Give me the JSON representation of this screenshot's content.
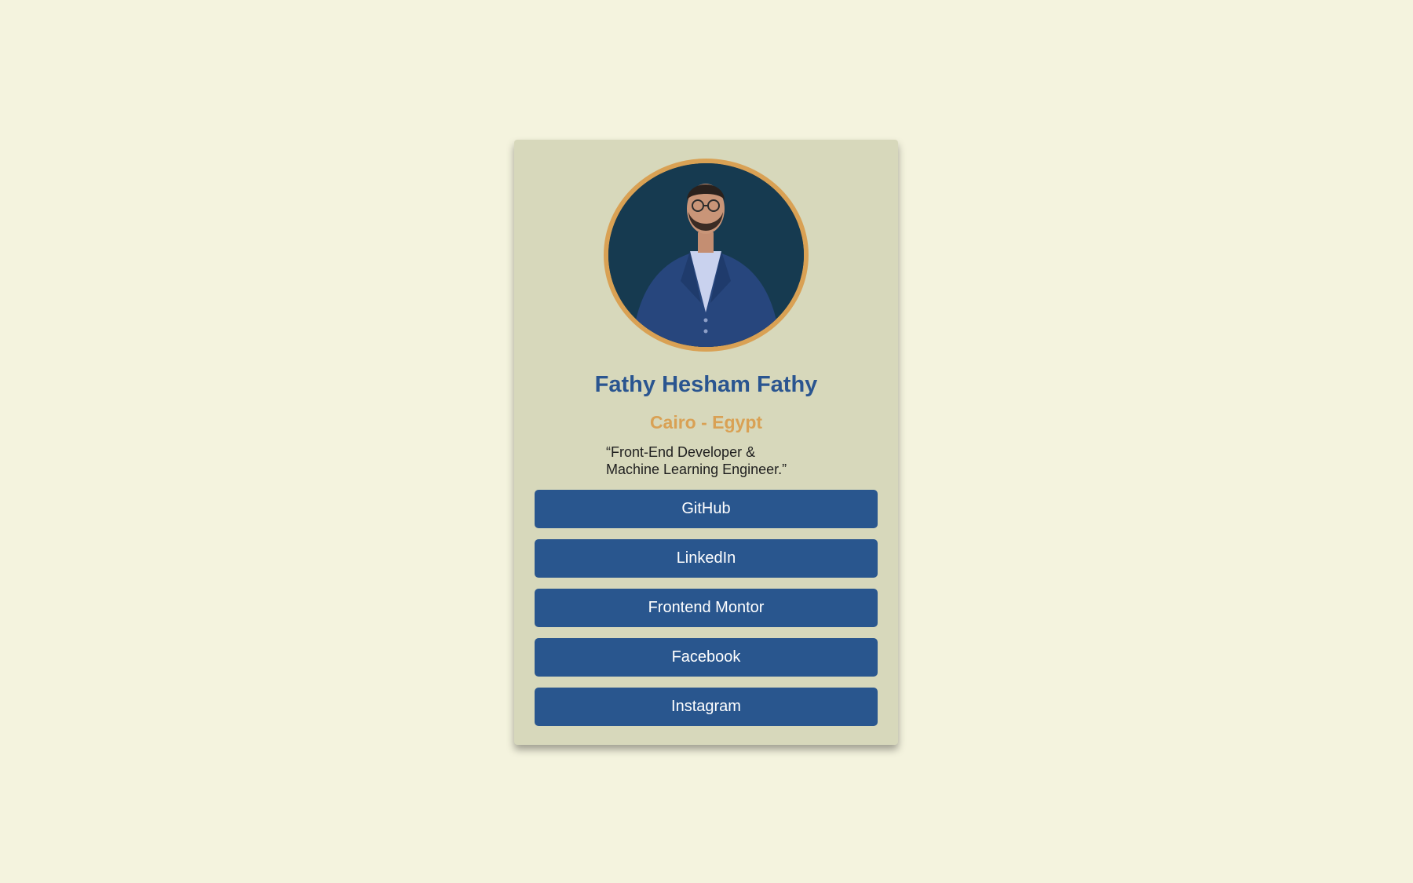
{
  "colors": {
    "background": "#f4f3de",
    "card": "#d7d8bb",
    "accent": "#d9a154",
    "primary": "#29568e",
    "avatar_bg": "#163a50"
  },
  "profile": {
    "avatar_icon": "profile-photo",
    "name": "Fathy Hesham Fathy",
    "location": "Cairo - Egypt",
    "bio_line1": "“Front-End Developer &",
    "bio_line2": "Machine Learning Engineer.”"
  },
  "links": [
    {
      "label": "GitHub"
    },
    {
      "label": "LinkedIn"
    },
    {
      "label": "Frontend Montor"
    },
    {
      "label": "Facebook"
    },
    {
      "label": "Instagram"
    }
  ]
}
